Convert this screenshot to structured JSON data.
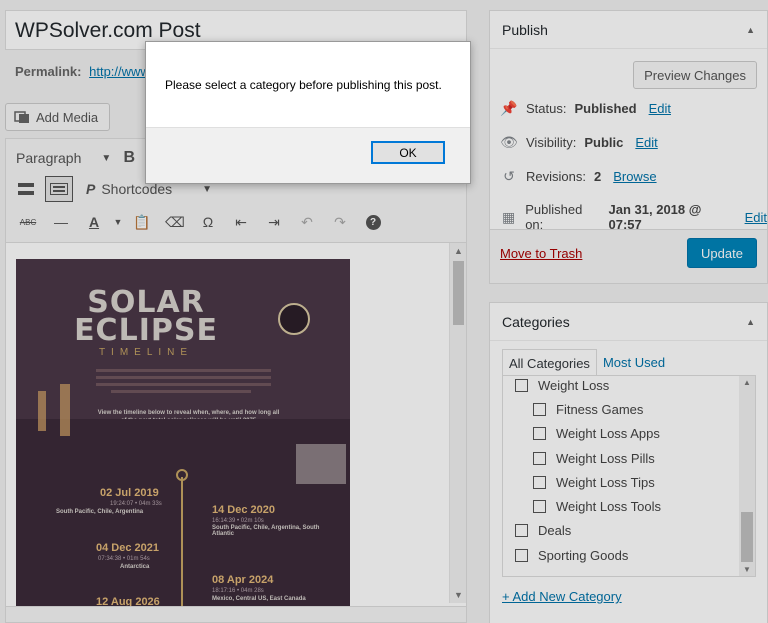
{
  "editor": {
    "post_title": "WPSolver.com Post",
    "permalink_label": "Permalink:",
    "permalink_url": "http://www",
    "add_media_label": "Add Media",
    "format_label": "Paragraph",
    "shortcodes_label": "Shortcodes"
  },
  "poster": {
    "title_line1": "SOLAR",
    "title_line2": "ECLIPSE",
    "subtitle": "TIMELINE",
    "intro": "View the timeline below to reveal when, where, and how long all of the next total solar eclipses will be until 2075",
    "events": [
      {
        "date": "02 Jul 2019",
        "detail": "19:24:07 • 04m 33s",
        "place": "South Pacific, Chile, Argentina"
      },
      {
        "date": "14 Dec 2020",
        "detail": "16:14:39 • 02m 10s",
        "place": "South Pacific, Chile, Argentina, South Atlantic"
      },
      {
        "date": "04 Dec 2021",
        "detail": "07:34:38 • 01m 54s",
        "place": "Antarctica"
      },
      {
        "date": "08 Apr 2024",
        "detail": "18:17:16 • 04m 28s",
        "place": "Mexico, Central US, East Canada"
      },
      {
        "date": "12 Aug 2026",
        "detail": "",
        "place": ""
      }
    ]
  },
  "publish": {
    "heading": "Publish",
    "preview_label": "Preview Changes",
    "status_label": "Status:",
    "status_value": "Published",
    "visibility_label": "Visibility:",
    "visibility_value": "Public",
    "revisions_label": "Revisions:",
    "revisions_value": "2",
    "browse_label": "Browse",
    "published_on_label": "Published on:",
    "published_on_value": "Jan 31, 2018 @ 07:57",
    "edit_label": "Edit",
    "trash_label": "Move to Trash",
    "update_label": "Update"
  },
  "categories": {
    "heading": "Categories",
    "tab_all": "All Categories",
    "tab_used": "Most Used",
    "items": [
      {
        "label": "Weight Loss",
        "level": 0,
        "checked": false
      },
      {
        "label": "Fitness Games",
        "level": 1,
        "checked": false
      },
      {
        "label": "Weight Loss Apps",
        "level": 1,
        "checked": false
      },
      {
        "label": "Weight Loss Pills",
        "level": 1,
        "checked": false
      },
      {
        "label": "Weight Loss Tips",
        "level": 1,
        "checked": false
      },
      {
        "label": "Weight Loss Tools",
        "level": 1,
        "checked": false
      },
      {
        "label": "Deals",
        "level": 0,
        "checked": false
      },
      {
        "label": "Sporting Goods",
        "level": 0,
        "checked": false
      }
    ],
    "add_new_label": "+ Add New Category"
  },
  "dialog": {
    "message": "Please select a category before publishing this post.",
    "ok_label": "OK"
  },
  "colors": {
    "link": "#0073aa",
    "primary_button": "#0085ba",
    "trash": "#a00000",
    "poster_bg": "#4a3747",
    "poster_accent": "#c7a564"
  }
}
